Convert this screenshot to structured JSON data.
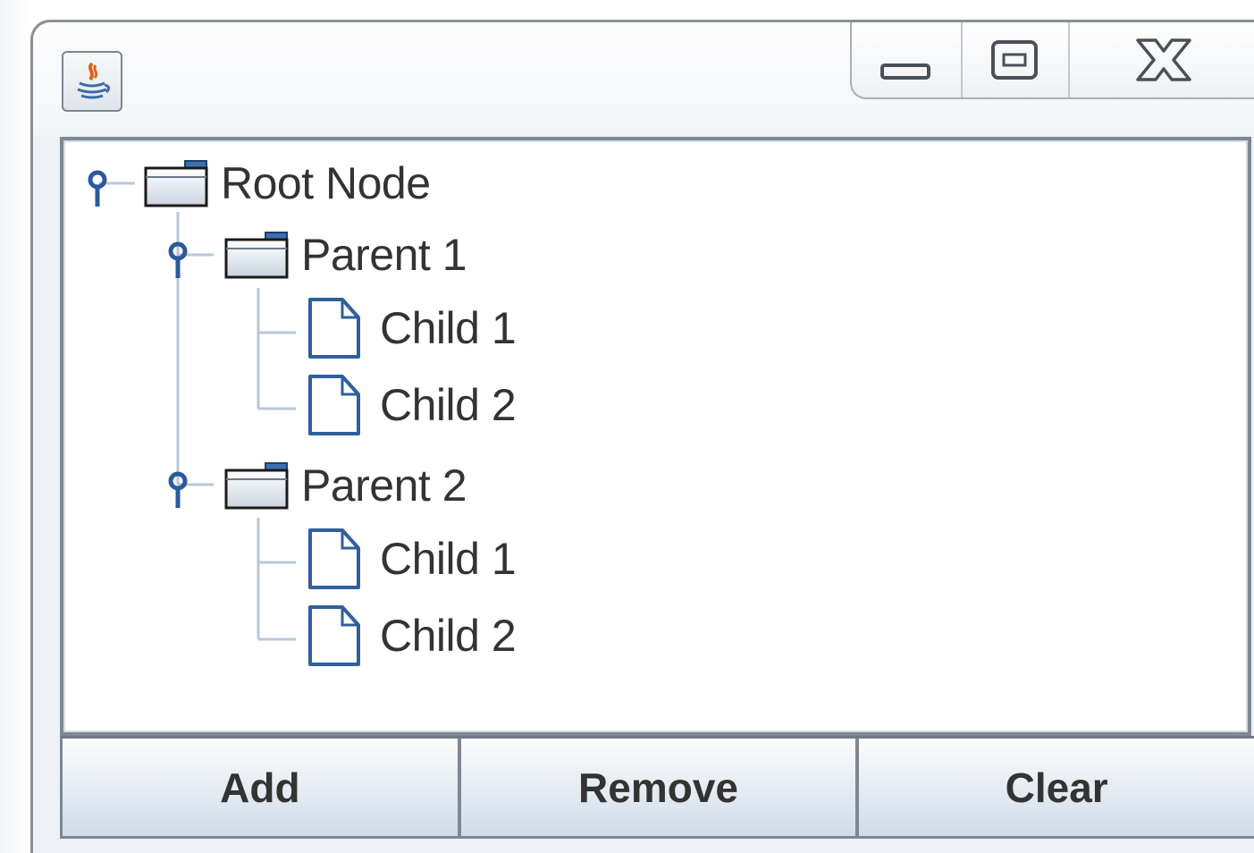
{
  "window": {
    "controls": {
      "minimize_icon": "minimize-icon",
      "maximize_icon": "restore-icon",
      "close_icon": "close-icon"
    }
  },
  "tree": {
    "nodes": [
      {
        "label": "Root Node",
        "type": "folder",
        "expanded": true
      },
      {
        "label": "Parent 1",
        "type": "folder",
        "expanded": true
      },
      {
        "label": "Child 1",
        "type": "leaf"
      },
      {
        "label": "Child 2",
        "type": "leaf"
      },
      {
        "label": "Parent 2",
        "type": "folder",
        "expanded": true
      },
      {
        "label": "Child 1",
        "type": "leaf"
      },
      {
        "label": "Child 2",
        "type": "leaf"
      }
    ]
  },
  "buttons": {
    "add": "Add",
    "remove": "Remove",
    "clear": "Clear"
  },
  "colors": {
    "tree_line": "#b8c7d9",
    "handle": "#2a5a9a",
    "icon_stroke": "#2f5f9e",
    "text": "#333333"
  }
}
